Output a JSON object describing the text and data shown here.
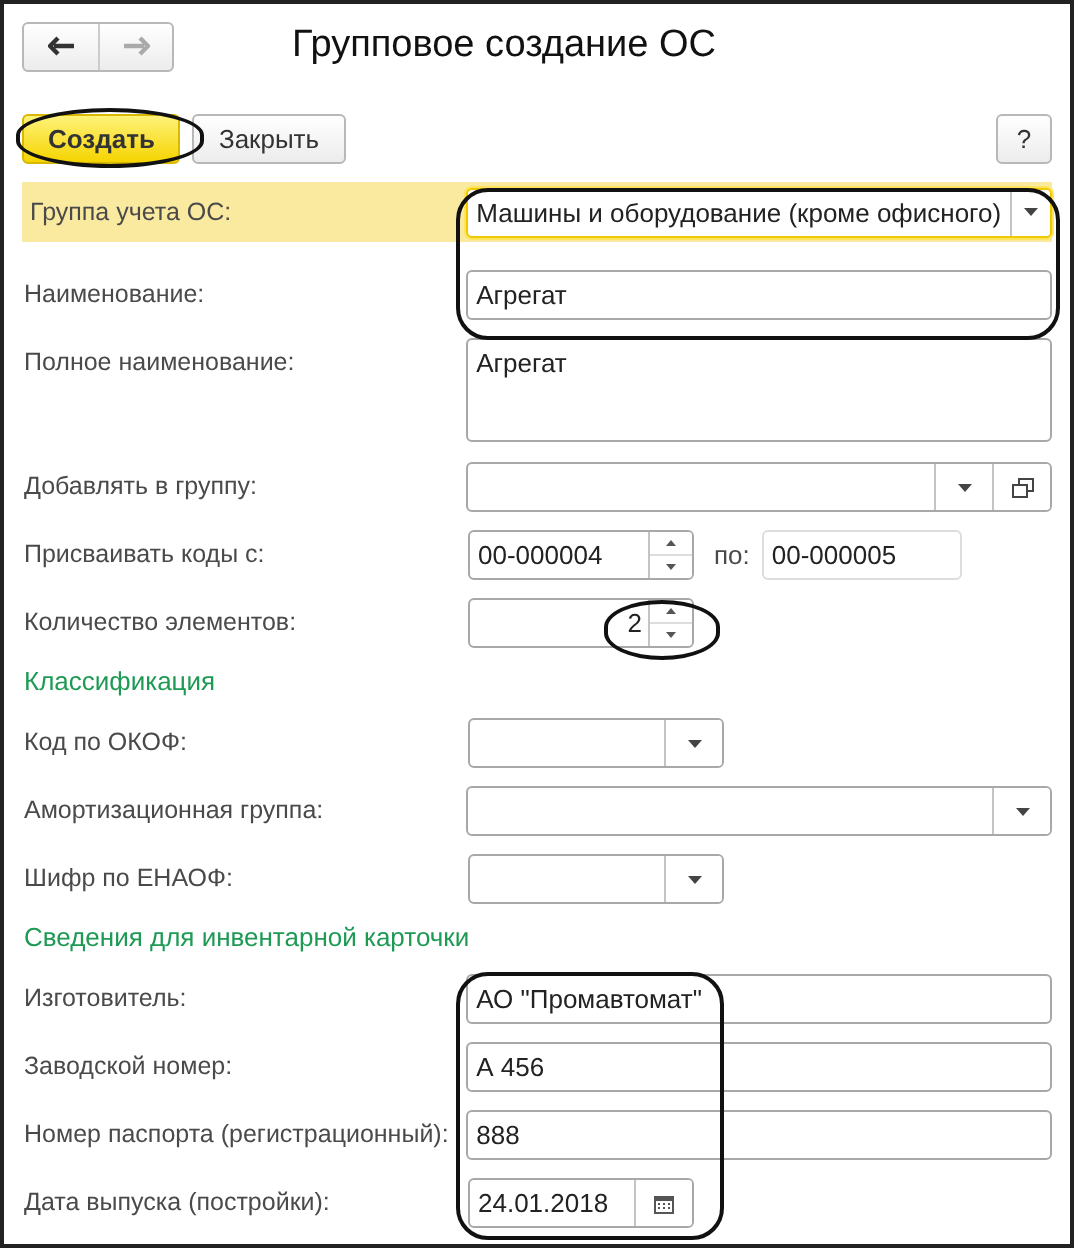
{
  "window": {
    "title": "Групповое создание ОС"
  },
  "toolbar": {
    "buttons": [
      {
        "label": "Создать",
        "kind": "default"
      },
      {
        "label": "Закрыть",
        "kind": "normal"
      }
    ],
    "help": "?"
  },
  "rows": [
    {
      "kind": "dropdown",
      "label": "Группа учета ОС:",
      "value": "Машины и оборудование (кроме офисного)",
      "wide": true,
      "focused": true
    },
    {
      "kind": "text",
      "label": "Наименование:",
      "value": "Агрегат",
      "wide": true
    },
    {
      "kind": "multiline",
      "label": "Полное наименование:",
      "value": "Агрегат",
      "wide": true
    },
    {
      "kind": "dropdown-open",
      "label": "Добавлять в группу:",
      "wide": true
    },
    {
      "kind": "range",
      "label": "Присваивать коды с:",
      "value": "00-000004",
      "to_label": "по:",
      "to_value": "00-000005"
    },
    {
      "kind": "number",
      "label": "Количество элементов:",
      "value": "2"
    },
    {
      "kind": "section",
      "label": "Классификация"
    },
    {
      "kind": "dropdown",
      "label": "Код по ОКОФ:",
      "wide": false
    },
    {
      "kind": "dropdown",
      "label": "Амортизационная группа:",
      "wide": true
    },
    {
      "kind": "dropdown",
      "label": "Шифр по ЕНАОФ:",
      "wide": false
    },
    {
      "kind": "section",
      "label": "Сведения для инвентарной карточки"
    },
    {
      "kind": "text",
      "label": "Изготовитель:",
      "value": "АО \"Промавтомат\"",
      "wide": true
    },
    {
      "kind": "text",
      "label": "Заводской номер:",
      "value": "А 456",
      "wide": true
    },
    {
      "kind": "text",
      "label": "Номер паспорта (регистрационный):",
      "value": "888",
      "wide": true
    },
    {
      "kind": "date",
      "label": "Дата выпуска (постройки):",
      "value": "24.01.2018"
    }
  ]
}
